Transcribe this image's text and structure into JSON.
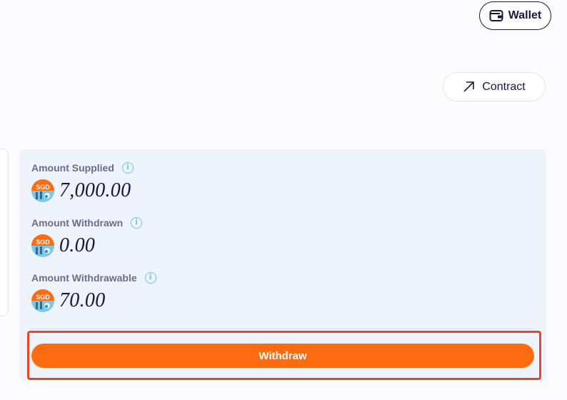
{
  "header": {
    "wallet_label": "Wallet",
    "contract_label": "Contract"
  },
  "stats": [
    {
      "label": "Amount Supplied",
      "currency": "SGD",
      "value": "7,000.00"
    },
    {
      "label": "Amount Withdrawn",
      "currency": "SGD",
      "value": "0.00"
    },
    {
      "label": "Amount Withdrawable",
      "currency": "SGD",
      "value": "70.00"
    }
  ],
  "actions": {
    "withdraw_label": "Withdraw"
  },
  "colors": {
    "primary": "#ff6b0f",
    "highlight": "#e8462a",
    "panel": "#eef4fb",
    "text": "#1b1640",
    "info": "#6cc3ef"
  },
  "icons": {
    "wallet": "wallet-icon",
    "contract": "arrow-up-right-icon",
    "info": "info-icon",
    "coin": "sgd-coin-icon"
  }
}
